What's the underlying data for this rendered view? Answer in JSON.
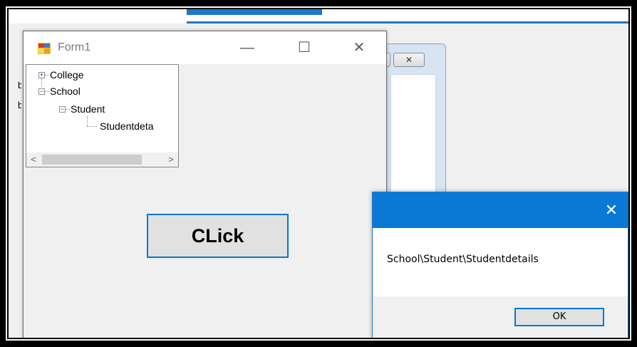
{
  "form1": {
    "title": "Form1",
    "controls": {
      "minimize": "—",
      "maximize": "☐",
      "close": "✕"
    }
  },
  "background_window": {
    "button_1": "",
    "button_2": "✕"
  },
  "treeview": {
    "nodes": [
      {
        "label": "College",
        "expander": "+"
      },
      {
        "label": "School",
        "expander": "−"
      },
      {
        "label": "Student",
        "expander": "−"
      },
      {
        "label": "Studentdeta"
      }
    ],
    "scroll_left": "<",
    "scroll_right": ">"
  },
  "clipped_labels": [
    "b",
    "b"
  ],
  "main_button": {
    "label": "CLick"
  },
  "message_box": {
    "close": "✕",
    "text": "School\\Student\\Studentdetails",
    "ok_label": "OK"
  },
  "colors": {
    "accent": "#0078d7",
    "titlebar_blue": "#0a79d6",
    "window_bg": "#f0f0f0"
  }
}
